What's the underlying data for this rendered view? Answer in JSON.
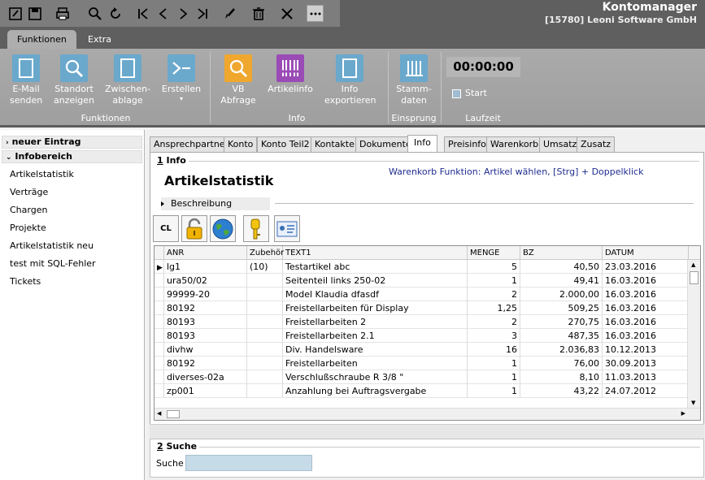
{
  "app": {
    "title": "Kontomanager",
    "subtitle": "[15780] Leoni Software GmbH"
  },
  "toolbar": {
    "icons": [
      "edit-icon",
      "save-icon",
      "print-icon",
      "search-icon",
      "refresh-icon",
      "first-icon",
      "prev-icon",
      "next-icon",
      "last-icon",
      "brush-icon",
      "delete-icon",
      "close-icon",
      "more-icon"
    ]
  },
  "ribbon": {
    "tabs": [
      {
        "label": "Funktionen"
      },
      {
        "label": "Extra"
      }
    ],
    "buttons": [
      {
        "label": "E-Mail\nsenden"
      },
      {
        "label": "Standort\nanzeigen"
      },
      {
        "label": "Zwischen-\nablage"
      },
      {
        "label": "Erstellen"
      },
      {
        "label": "VB\nAbfrage"
      },
      {
        "label": "Artikelinfo"
      },
      {
        "label": "Info\nexportieren"
      },
      {
        "label": "Stamm-\ndaten"
      }
    ],
    "groups": {
      "funktionen": "Funktionen",
      "info": "Info",
      "einsprung": "Einsprung",
      "laufzeit": "Laufzeit"
    },
    "timer": "00:00:00",
    "start_label": "Start"
  },
  "sidebar": {
    "new_entry": "neuer Eintrag",
    "info_area": "Infobereich",
    "items": [
      "Artikelstatistik",
      "Verträge",
      "Chargen",
      "Projekte",
      "Artikelstatistik neu",
      "test mit SQL-Fehler",
      "Tickets"
    ]
  },
  "tabs": [
    "Ansprechpartner",
    "Konto",
    "Konto Teil2",
    "Kontakte",
    "Dokumente",
    "Info",
    "Preisinfo",
    "Warenkorb",
    "Umsatz",
    "Zusatz"
  ],
  "info": {
    "section_num": "1",
    "section_label": "Info",
    "heading": "Artikelstatistik",
    "hint": "Warenkorb Funktion: Artikel wählen, [Strg] + Doppelklick",
    "description": "Beschreibung",
    "cl_label": "CL"
  },
  "grid": {
    "columns": [
      "ANR",
      "Zubehör",
      "TEXT1",
      "MENGE",
      "BZ",
      "DATUM"
    ],
    "rows": [
      [
        "lg1",
        "(10)",
        "Testartikel abc",
        "5",
        "40,50",
        "23.03.2016"
      ],
      [
        "ura50/02",
        "",
        "Seitenteil links     250-02",
        "1",
        "49,41",
        "16.03.2016"
      ],
      [
        "99999-20",
        "",
        "Model Klaudia dfasdf",
        "2",
        "2.000,00",
        "16.03.2016"
      ],
      [
        "80192",
        "",
        "Freistellarbeiten für Display",
        "1,25",
        "509,25",
        "16.03.2016"
      ],
      [
        "80193",
        "",
        "Freistellarbeiten 2",
        "2",
        "270,75",
        "16.03.2016"
      ],
      [
        "80193",
        "",
        "Freistellarbeiten 2.1",
        "3",
        "487,35",
        "16.03.2016"
      ],
      [
        "divhw",
        "",
        "Div. Handelsware",
        "16",
        "2.036,83",
        "10.12.2013"
      ],
      [
        "80192",
        "",
        "Freistellarbeiten",
        "1",
        "76,00",
        "30.09.2013"
      ],
      [
        "diverses-02a",
        "",
        "Verschlußschraube  R 3/8 \"",
        "1",
        "8,10",
        "11.03.2013"
      ],
      [
        "zp001",
        "",
        "Anzahlung bei Auftragsvergabe",
        "1",
        "43,22",
        "24.07.2012"
      ]
    ]
  },
  "search": {
    "section_num": "2",
    "section_label": "Suche",
    "label": "Suche",
    "value": ""
  }
}
